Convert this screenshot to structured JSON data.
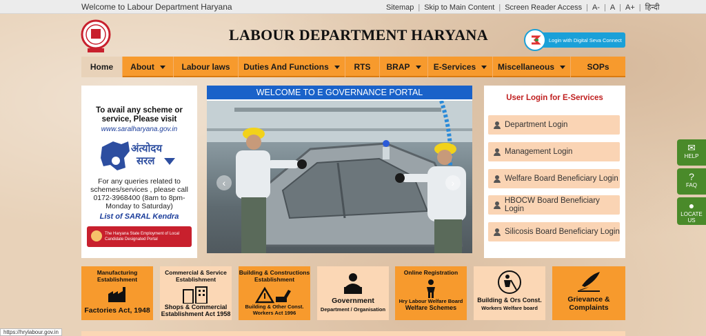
{
  "topbar": {
    "welcome": "Welcome to Labour Department Haryana",
    "links": [
      "Sitemap",
      "Skip to Main Content",
      "Screen Reader Access",
      "A-",
      "A",
      "A+",
      "हिन्दी"
    ]
  },
  "header": {
    "title": "LABOUR DEPARTMENT HARYANA",
    "dsc_label": "Login with Digital Seva Connect"
  },
  "nav": {
    "items": [
      {
        "label": "Home",
        "dropdown": false
      },
      {
        "label": "About",
        "dropdown": true
      },
      {
        "label": "Labour laws",
        "dropdown": false
      },
      {
        "label": "Duties And Functions",
        "dropdown": true
      },
      {
        "label": "RTS",
        "dropdown": false
      },
      {
        "label": "BRAP",
        "dropdown": true
      },
      {
        "label": "E-Services",
        "dropdown": true
      },
      {
        "label": "Miscellaneous",
        "dropdown": true
      },
      {
        "label": "SOPs",
        "dropdown": false
      }
    ]
  },
  "left_panel": {
    "heading": "To avail any scheme or service, Please visit",
    "link": "www.saralharyana.gov.in",
    "saral_hindi_1": "अंत्योदय",
    "saral_hindi_2": "सरल",
    "queries": "For any queries related to schemes/services , please call 0172-3968400 (8am to 8pm- Monday to Saturday)",
    "list_link": "List of SARAL Kendra",
    "banner": "The Haryana State Employment of Local Candidate Designated Portal"
  },
  "carousel": {
    "title": "WELCOME TO E GOVERNANCE PORTAL"
  },
  "login": {
    "heading": "User Login for E-Services",
    "buttons": [
      "Department Login",
      "Management Login",
      "Welfare Board Beneficiary Login",
      "HBOCW Board Beneficiary Login",
      "Silicosis Board Beneficiary Login"
    ]
  },
  "side": {
    "help": "HELP",
    "faq": "FAQ",
    "locate": "LOCATE US"
  },
  "tiles": [
    {
      "top": "Manufacturing Establishment",
      "bottom": "Factories Act, 1948",
      "icon": "factory-icon"
    },
    {
      "top": "Commercial & Service Establishment",
      "bottom": "Shops & Commercial Establishment Act 1958",
      "icon": "buildings-icon"
    },
    {
      "top": "Building & Constructions Establishment",
      "bottom": "Building & Other Const. Workers Act 1996",
      "icon": "construction-icon"
    },
    {
      "top": "",
      "bottom1": "Government",
      "bottom2": "Department / Organisation",
      "icon": "official-icon"
    },
    {
      "top": "Online Registration",
      "bottom1": "Hry Labour Welfare Board",
      "bottom2": "Welfare Schemes",
      "icon": "worker-icon"
    },
    {
      "top": "",
      "bottom1": "Building & Ors Const.",
      "bottom2": "Workers Welfare board",
      "icon": "digging-worker-icon"
    },
    {
      "top": "",
      "bottom": "Grievance & Complaints",
      "icon": "quill-icon"
    }
  ],
  "status_url": "https://hrylabour.gov.in"
}
